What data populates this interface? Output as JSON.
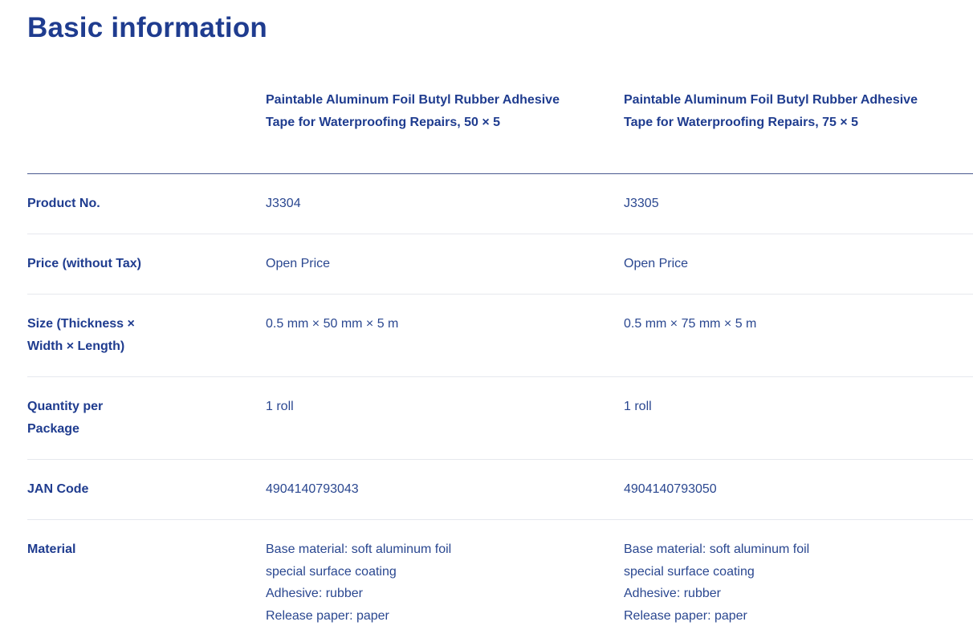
{
  "page": {
    "title": "Basic information"
  },
  "table": {
    "columns": [
      "Paintable Aluminum Foil Butyl Rubber Adhesive Tape for Waterproofing Repairs, 50 × 5",
      "Paintable Aluminum Foil Butyl Rubber Adhesive Tape for Waterproofing Repairs, 75 × 5"
    ],
    "rows": {
      "product_no": {
        "label": "Product No.",
        "values": [
          "J3304",
          "J3305"
        ]
      },
      "price": {
        "label": "Price (without Tax)",
        "values": [
          "Open Price",
          "Open Price"
        ]
      },
      "size": {
        "label": "Size (Thickness × Width × Length)",
        "values": [
          "0.5 mm × 50 mm × 5 m",
          "0.5 mm × 75 mm × 5 m"
        ]
      },
      "quantity": {
        "label": "Quantity per Package",
        "values": [
          "1 roll",
          "1 roll"
        ]
      },
      "jan": {
        "label": "JAN Code",
        "values": [
          "4904140793043",
          "4904140793050"
        ]
      },
      "material": {
        "label": "Material",
        "values": [
          [
            "Base material: soft aluminum foil",
            "special surface coating",
            "Adhesive: rubber",
            "Release paper: paper"
          ],
          [
            "Base material: soft aluminum foil",
            "special surface coating",
            "Adhesive: rubber",
            "Release paper: paper"
          ]
        ]
      }
    }
  },
  "colors": {
    "heading": "#1f3c8f",
    "text": "#2a4790",
    "header_rule": "#4a5a8f",
    "row_rule": "#e6e8ee"
  }
}
